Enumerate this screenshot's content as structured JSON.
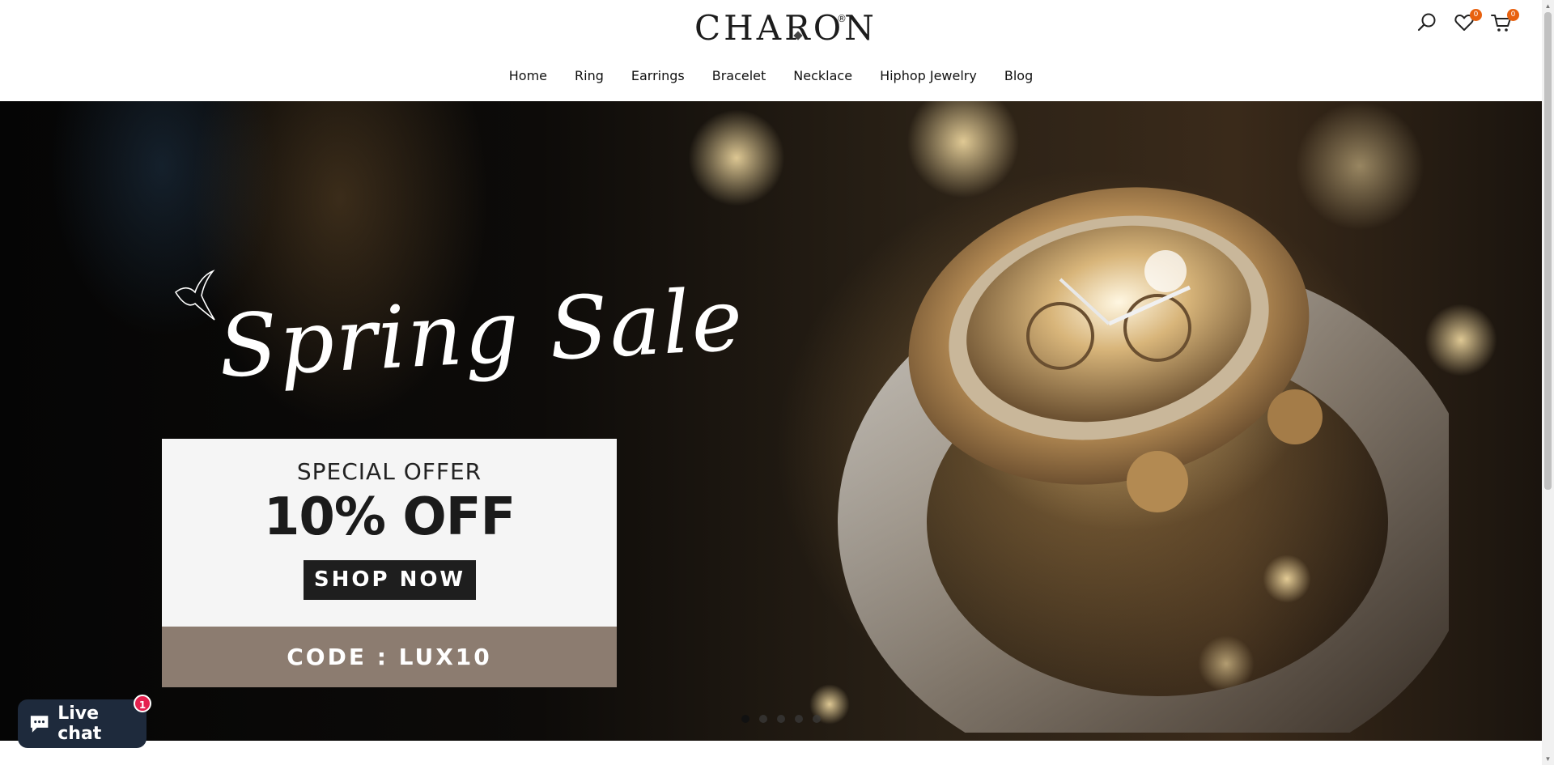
{
  "header": {
    "logo_text": "CHARON",
    "logo_mark": "®",
    "icons": [
      {
        "name": "search-icon"
      },
      {
        "name": "wishlist-heart-icon",
        "badge": "0"
      },
      {
        "name": "cart-icon",
        "badge": "0"
      }
    ]
  },
  "nav": {
    "items": [
      "Home",
      "Ring",
      "Earrings",
      "Bracelet",
      "Necklace",
      "Hiphop Jewelry",
      "Blog"
    ]
  },
  "hero": {
    "script_title": "Spring Sale",
    "offer_kicker": "SPECIAL OFFER",
    "offer_main": "10% OFF",
    "cta_label": "SHOP NOW",
    "code_label": "CODE : LUX10",
    "slide_count": 5,
    "active_slide": 1
  },
  "livechat": {
    "label": "Live chat",
    "badge": "1"
  },
  "colors": {
    "badge": "#e8610f",
    "code_box": "#8c7c70",
    "livechat_bg": "#1e2a3c",
    "livechat_badge": "#e5214f"
  }
}
